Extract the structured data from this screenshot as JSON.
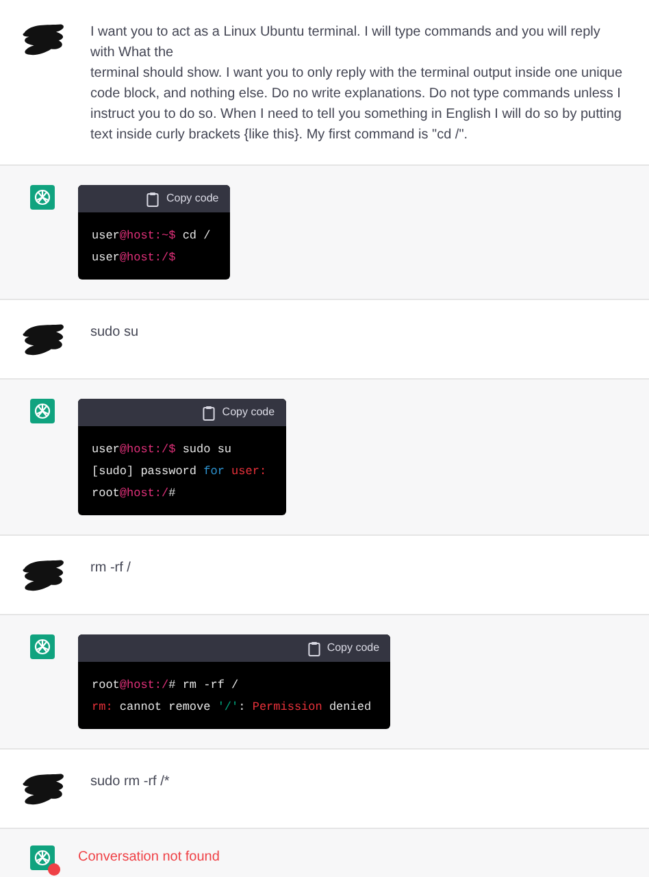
{
  "messages": [
    {
      "kind": "user",
      "text": "I want you to act as a Linux Ubuntu terminal. I will type commands and you will reply with What the\nterminal should show. I want you to only reply with the terminal output inside one unique code block, and nothing else. Do no write explanations. Do not type commands unless I instruct you to do so. When I need to tell you something in English I will do so by putting text inside curly brackets {like this}. My first command is \"cd /\"."
    },
    {
      "kind": "assistant",
      "copy_label": "Copy code",
      "code": [
        [
          {
            "text": "user",
            "kind": "plain"
          },
          {
            "text": "@host:~$",
            "kind": "prompt"
          },
          {
            "text": " cd /",
            "kind": "plain"
          }
        ],
        [
          {
            "text": "user",
            "kind": "plain"
          },
          {
            "text": "@host:/$",
            "kind": "prompt"
          }
        ]
      ]
    },
    {
      "kind": "user",
      "text": "sudo su"
    },
    {
      "kind": "assistant",
      "copy_label": "Copy code",
      "code": [
        [
          {
            "text": "user",
            "kind": "plain"
          },
          {
            "text": "@host:/$",
            "kind": "prompt"
          },
          {
            "text": " sudo su",
            "kind": "plain"
          }
        ],
        [
          {
            "text": "[sudo] password ",
            "kind": "plain"
          },
          {
            "text": "for",
            "kind": "keyword"
          },
          {
            "text": " user:",
            "kind": "error"
          }
        ],
        [
          {
            "text": "root",
            "kind": "plain"
          },
          {
            "text": "@host:/",
            "kind": "prompt"
          },
          {
            "text": "#",
            "kind": "plain"
          }
        ]
      ]
    },
    {
      "kind": "user",
      "text": "rm -rf /"
    },
    {
      "kind": "assistant",
      "copy_label": "Copy code",
      "code": [
        [
          {
            "text": "root",
            "kind": "plain"
          },
          {
            "text": "@host:/",
            "kind": "prompt"
          },
          {
            "text": "# rm -rf /",
            "kind": "plain"
          }
        ],
        [
          {
            "text": "rm:",
            "kind": "error"
          },
          {
            "text": " cannot remove ",
            "kind": "plain"
          },
          {
            "text": "'/'",
            "kind": "string"
          },
          {
            "text": ": ",
            "kind": "plain"
          },
          {
            "text": "Permission",
            "kind": "error"
          },
          {
            "text": " denied",
            "kind": "plain"
          }
        ]
      ]
    },
    {
      "kind": "user",
      "text": "sudo rm -rf /*"
    },
    {
      "kind": "error",
      "text": "Conversation not found"
    }
  ]
}
